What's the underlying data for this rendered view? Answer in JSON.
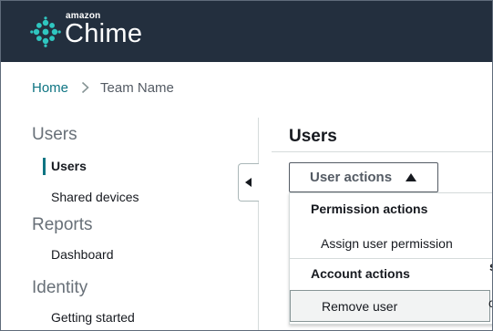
{
  "header": {
    "logo_small": "amazon",
    "logo_big": "Chime",
    "background": "#232f3e",
    "icon_color": "#2fc6c0"
  },
  "breadcrumb": {
    "home": "Home",
    "current": "Team Name"
  },
  "sidebar": {
    "sections": [
      {
        "label": "Users",
        "items": [
          {
            "label": "Users",
            "active": true
          },
          {
            "label": "Shared devices",
            "active": false
          }
        ]
      },
      {
        "label": "Reports",
        "items": [
          {
            "label": "Dashboard",
            "active": false
          }
        ]
      },
      {
        "label": "Identity",
        "items": [
          {
            "label": "Getting started",
            "active": false
          }
        ]
      }
    ],
    "collapse_icon": "caret-left-icon"
  },
  "main": {
    "title": "Users",
    "actions_button": "User actions",
    "menu": {
      "groups": [
        {
          "label": "Permission actions",
          "items": [
            "Assign user permission"
          ]
        },
        {
          "label": "Account actions",
          "items": [
            "Remove user"
          ]
        }
      ],
      "hovered_item": "Remove user"
    },
    "peek_bold": "s",
    "peek_regular": "c"
  },
  "colors": {
    "accent": "#0f7583",
    "text": "#16191f",
    "muted": "#687078",
    "hover_bg": "#f2f3f3"
  }
}
